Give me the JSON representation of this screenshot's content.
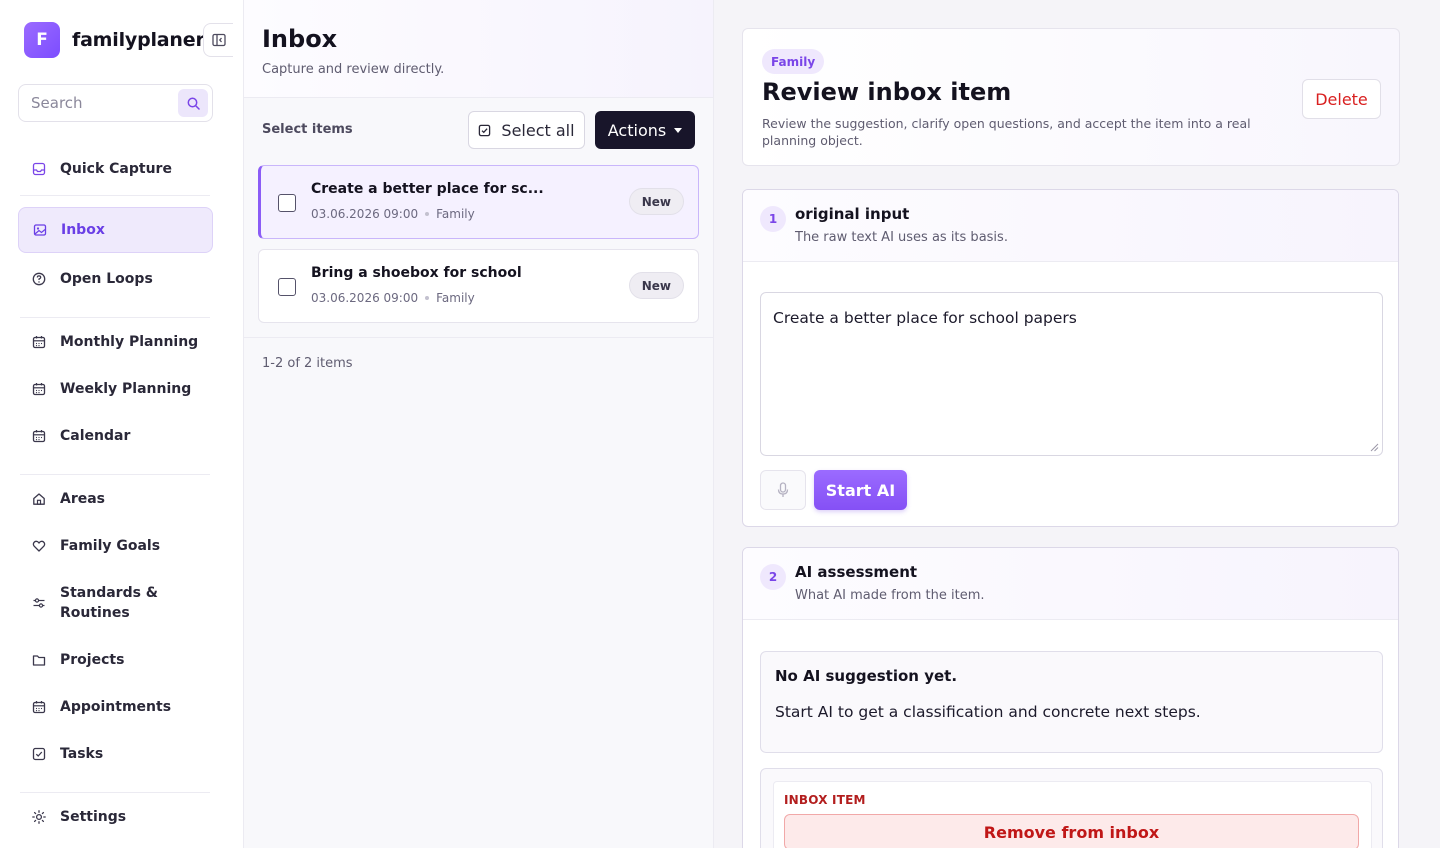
{
  "app": {
    "logo_letter": "F",
    "name": "familyplaner"
  },
  "search": {
    "placeholder": "Search"
  },
  "nav": {
    "quick_capture": "Quick Capture",
    "inbox": "Inbox",
    "open_loops": "Open Loops",
    "monthly_planning": "Monthly Planning",
    "weekly_planning": "Weekly Planning",
    "calendar": "Calendar",
    "areas": "Areas",
    "family_goals": "Family Goals",
    "standards_routines_line1": "Standards &",
    "standards_routines_line2": "Routines",
    "projects": "Projects",
    "appointments": "Appointments",
    "tasks": "Tasks",
    "settings": "Settings"
  },
  "inbox": {
    "title": "Inbox",
    "subtitle": "Capture and review directly.",
    "select_label": "Select items",
    "select_all": "Select all",
    "actions": "Actions",
    "items": [
      {
        "title": "Create a better place for sc...",
        "date": "03.06.2026 09:00",
        "area": "Family",
        "status": "New"
      },
      {
        "title": "Bring a shoebox for school",
        "date": "03.06.2026 09:00",
        "area": "Family",
        "status": "New"
      }
    ],
    "pagination": "1-2 of 2 items"
  },
  "review": {
    "tag": "Family",
    "title": "Review inbox item",
    "description": "Review the suggestion, clarify open questions, and accept the item into a real planning object.",
    "delete_label": "Delete"
  },
  "section1": {
    "number": "1",
    "title": "original input",
    "subtitle": "The raw text AI uses as its basis.",
    "input_value": "Create a better place for school papers",
    "start_ai": "Start AI"
  },
  "section2": {
    "number": "2",
    "title": "AI assessment",
    "subtitle": "What AI made from the item.",
    "empty_title": "No AI suggestion yet.",
    "empty_text": "Start AI to get a classification and concrete next steps.",
    "inbox_item_label": "INBOX ITEM",
    "remove_label": "Remove from inbox"
  },
  "colors": {
    "accent": "#8b5cf6",
    "dark_button": "#18152a",
    "danger": "#c01717"
  }
}
